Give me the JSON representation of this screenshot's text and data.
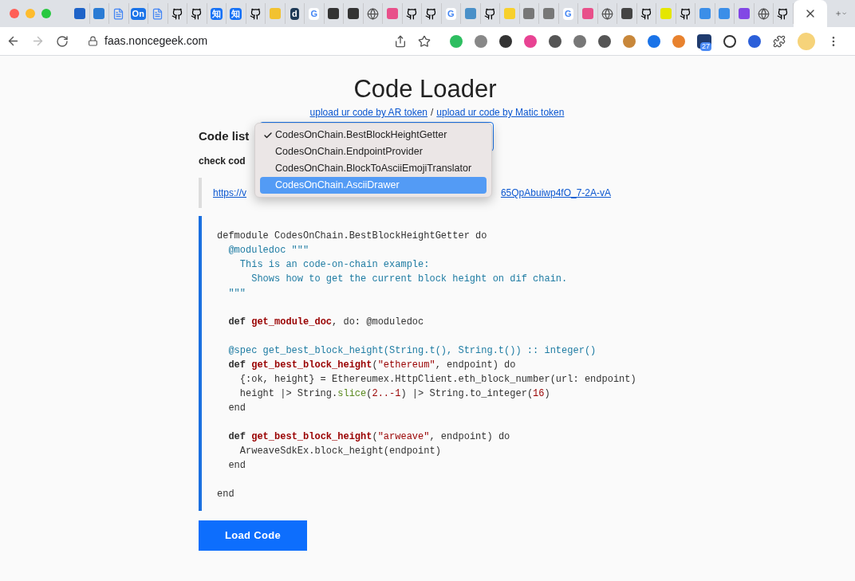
{
  "browser": {
    "tabs": [
      {
        "kind": "logo",
        "color": "#1e63c8",
        "selected": false
      },
      {
        "kind": "logo",
        "color": "#2a7bd4",
        "selected": false
      },
      {
        "kind": "doc",
        "selected": false
      },
      {
        "kind": "letter",
        "glyph": "On",
        "color": "#1a73e8",
        "selected": false
      },
      {
        "kind": "doc",
        "selected": false
      },
      {
        "kind": "github",
        "selected": false
      },
      {
        "kind": "github",
        "selected": false
      },
      {
        "kind": "letter",
        "glyph": "知",
        "color": "#1772f6",
        "selected": false
      },
      {
        "kind": "letter",
        "glyph": "知",
        "color": "#1772f6",
        "selected": false
      },
      {
        "kind": "github",
        "selected": false
      },
      {
        "kind": "logo",
        "color": "#f2c230",
        "selected": false
      },
      {
        "kind": "letter",
        "glyph": "d",
        "color": "#1f3b57",
        "selected": false
      },
      {
        "kind": "letter",
        "glyph": "G",
        "color": "#ffffff",
        "selected": false
      },
      {
        "kind": "logo",
        "color": "#333333",
        "selected": false
      },
      {
        "kind": "logo",
        "color": "#333333",
        "selected": false
      },
      {
        "kind": "globe",
        "selected": false
      },
      {
        "kind": "logo",
        "color": "#e8508a",
        "selected": false
      },
      {
        "kind": "github",
        "selected": false
      },
      {
        "kind": "github",
        "selected": false
      },
      {
        "kind": "letter",
        "glyph": "G",
        "color": "#ffffff",
        "selected": false
      },
      {
        "kind": "logo",
        "color": "#4a90c8",
        "selected": false
      },
      {
        "kind": "github",
        "selected": false
      },
      {
        "kind": "logo",
        "color": "#f7d02c",
        "selected": false
      },
      {
        "kind": "logo",
        "color": "#777777",
        "selected": false
      },
      {
        "kind": "logo",
        "color": "#777777",
        "selected": false
      },
      {
        "kind": "letter",
        "glyph": "G",
        "color": "#ffffff",
        "selected": false
      },
      {
        "kind": "logo",
        "color": "#e8508a",
        "selected": false
      },
      {
        "kind": "globe",
        "selected": false
      },
      {
        "kind": "logo",
        "color": "#444444",
        "selected": false
      },
      {
        "kind": "github",
        "selected": false
      },
      {
        "kind": "logo",
        "color": "#e5e600",
        "selected": false
      },
      {
        "kind": "github",
        "selected": false
      },
      {
        "kind": "logo",
        "color": "#3b8ee8",
        "selected": false
      },
      {
        "kind": "logo",
        "color": "#3b8ee8",
        "selected": false
      },
      {
        "kind": "logo",
        "color": "#8247e5",
        "selected": false
      },
      {
        "kind": "globe",
        "selected": false
      },
      {
        "kind": "github",
        "selected": false
      },
      {
        "kind": "blank",
        "selected": true
      }
    ],
    "url": "faas.noncegeek.com",
    "extension_badge": "27"
  },
  "page": {
    "title": "Code Loader",
    "links": [
      "upload ur code by AR token",
      "upload ur code by Matic token"
    ],
    "link_separator": "/",
    "code_list_label": "Code list",
    "check_label": "check cod",
    "url_start": "https://v",
    "url_end": "65QpAbuiwp4fO_7-2A-vA",
    "dropdown": {
      "options": [
        {
          "label": "CodesOnChain.BestBlockHeightGetter",
          "checked": true,
          "selected": false
        },
        {
          "label": "CodesOnChain.EndpointProvider",
          "checked": false,
          "selected": false
        },
        {
          "label": "CodesOnChain.BlockToAsciiEmojiTranslator",
          "checked": false,
          "selected": false
        },
        {
          "label": "CodesOnChain.AsciiDrawer",
          "checked": false,
          "selected": true
        }
      ]
    },
    "code_lines": [
      {
        "kind": "code",
        "tokens": [
          {
            "text": "defmodule CodesOnChain.BestBlockHeightGetter do",
            "kind": "plain"
          }
        ]
      },
      {
        "kind": "code",
        "tokens": [
          {
            "text": "  @moduledoc \"\"\"",
            "kind": "doc"
          }
        ]
      },
      {
        "kind": "code",
        "tokens": [
          {
            "text": "    This is an code-on-chain example:",
            "kind": "doc"
          }
        ]
      },
      {
        "kind": "code",
        "tokens": [
          {
            "text": "      Shows how to get the current block height on dif chain.",
            "kind": "doc"
          }
        ]
      },
      {
        "kind": "code",
        "tokens": [
          {
            "text": "  \"\"\"",
            "kind": "doc"
          }
        ]
      },
      {
        "kind": "blank"
      },
      {
        "kind": "code",
        "tokens": [
          {
            "text": "  def ",
            "kind": "keyword"
          },
          {
            "text": "get_module_doc",
            "kind": "func"
          },
          {
            "text": ", do: @moduledoc",
            "kind": "plain"
          }
        ]
      },
      {
        "kind": "blank"
      },
      {
        "kind": "code",
        "tokens": [
          {
            "text": "  @spec get_best_block_height(String.t(), String.t()) :: integer()",
            "kind": "doc"
          }
        ]
      },
      {
        "kind": "code",
        "tokens": [
          {
            "text": "  def ",
            "kind": "keyword"
          },
          {
            "text": "get_best_block_height",
            "kind": "func"
          },
          {
            "text": "(",
            "kind": "plain"
          },
          {
            "text": "\"ethereum\"",
            "kind": "string"
          },
          {
            "text": ", endpoint) do",
            "kind": "plain"
          }
        ]
      },
      {
        "kind": "code",
        "tokens": [
          {
            "text": "    {:ok, height} = Ethereumex.HttpClient.eth_block_number(url: endpoint)",
            "kind": "plain"
          }
        ]
      },
      {
        "kind": "code",
        "tokens": [
          {
            "text": "    height |> String.",
            "kind": "plain"
          },
          {
            "text": "slice",
            "kind": "builtin"
          },
          {
            "text": "(",
            "kind": "plain"
          },
          {
            "text": "2..-1",
            "kind": "string"
          },
          {
            "text": ") |> String.to_integer(",
            "kind": "plain"
          },
          {
            "text": "16",
            "kind": "string"
          },
          {
            "text": ")",
            "kind": "plain"
          }
        ]
      },
      {
        "kind": "code",
        "tokens": [
          {
            "text": "  end",
            "kind": "plain"
          }
        ]
      },
      {
        "kind": "blank"
      },
      {
        "kind": "code",
        "tokens": [
          {
            "text": "  def ",
            "kind": "keyword"
          },
          {
            "text": "get_best_block_height",
            "kind": "func"
          },
          {
            "text": "(",
            "kind": "plain"
          },
          {
            "text": "\"arweave\"",
            "kind": "string"
          },
          {
            "text": ", endpoint) do",
            "kind": "plain"
          }
        ]
      },
      {
        "kind": "code",
        "tokens": [
          {
            "text": "    ArweaveSdkEx.block_height(endpoint)",
            "kind": "plain"
          }
        ]
      },
      {
        "kind": "code",
        "tokens": [
          {
            "text": "  end",
            "kind": "plain"
          }
        ]
      },
      {
        "kind": "blank"
      },
      {
        "kind": "code",
        "tokens": [
          {
            "text": "end",
            "kind": "plain"
          }
        ]
      }
    ],
    "load_button": "Load Code"
  }
}
